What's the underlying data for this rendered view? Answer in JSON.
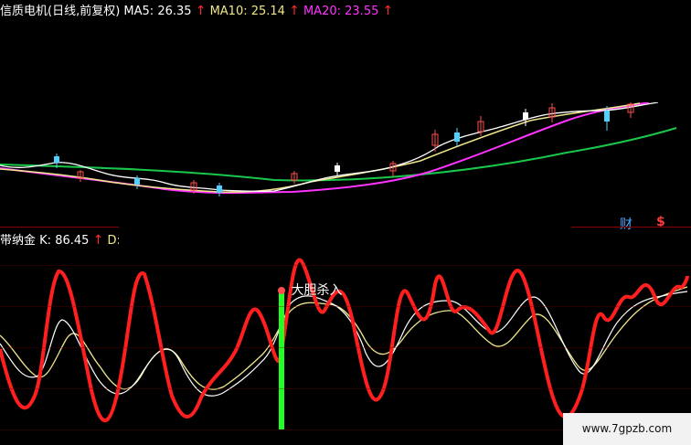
{
  "top_panel": {
    "title": "信质电机(日线,前复权)",
    "ma5_label": "MA5:",
    "ma5_value": "26.35",
    "ma10_label": "MA10:",
    "ma10_value": "25.14",
    "ma20_label": "MA20:",
    "ma20_value": "23.55",
    "arrow": "↑"
  },
  "bottom_panel": {
    "name": "带纳金",
    "k_label": "K:",
    "k_value": "86.45",
    "d_label": "D:",
    "arrow": "↑"
  },
  "icons": {
    "finance_icon": "财",
    "dollar_icon": "$"
  },
  "annotation": {
    "text": "大胆杀入"
  },
  "watermark": {
    "text": "www.7gpzb.com"
  },
  "colors": {
    "background": "#000000",
    "price_line": "#ffffff",
    "ma10": "#f0e68c",
    "ma20": "#ff33ff",
    "ma_long": "#19c84b",
    "k_line": "#ff1f1f",
    "d_line": "#ffffff",
    "j_line": "#f0e68c",
    "signal_bar": "#22ff22"
  }
}
